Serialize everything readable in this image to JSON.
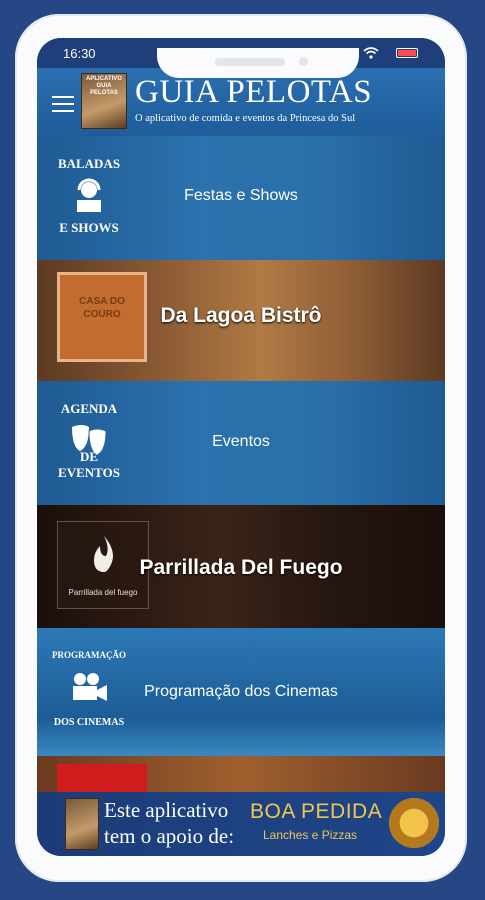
{
  "statusbar": {
    "time": "16:30"
  },
  "header": {
    "title": "GUIA PELOTAS",
    "subtitle": "O aplicativo de comida e eventos da Princesa do Sul",
    "logo_text": "APLICATIVO GUIA PELOTAS"
  },
  "rows": [
    {
      "tile_top": "BALADAS",
      "tile_bottom": "E SHOWS",
      "label": "Festas e Shows"
    },
    {
      "tile_text": "CASA DO COURO",
      "label": "Da Lagoa Bistrô"
    },
    {
      "tile_top": "AGENDA",
      "tile_bottom": "DE EVENTOS",
      "label": "Eventos"
    },
    {
      "tile_text": "Parrillada del fuego",
      "label": "Parrillada Del Fuego"
    },
    {
      "tile_top": "PROGRAMAÇÃO",
      "tile_bottom": "DOS CINEMAS",
      "label": "Programação dos Cinemas"
    }
  ],
  "banner": {
    "line1": "Este aplicativo",
    "line2": "tem o apoio de:",
    "brand": "BOA PEDIDA",
    "brand_sub": "Lanches e Pizzas"
  },
  "colors": {
    "background": "#264785",
    "appbar": "#2a6fb0",
    "brand": "#f0c850"
  }
}
